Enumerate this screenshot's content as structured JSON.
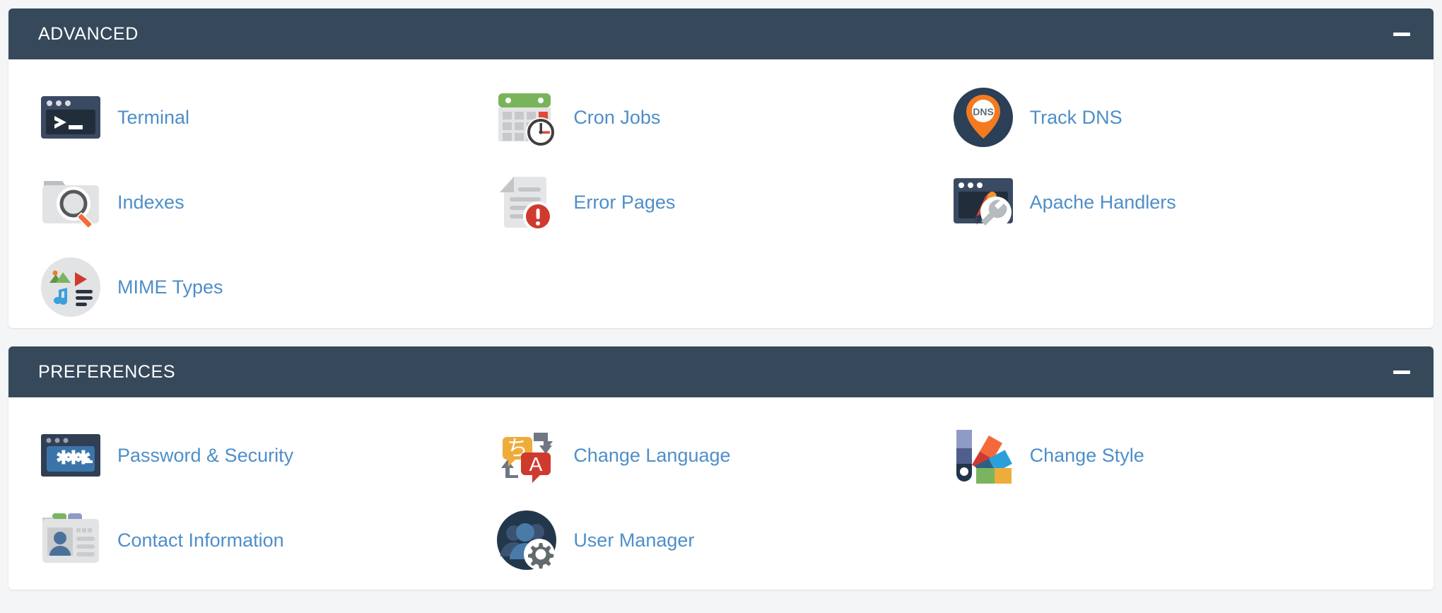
{
  "theme": {
    "header_bg": "#36495a",
    "panel_bg": "#ffffff",
    "page_bg": "#f4f5f6",
    "link_color": "#4f8ec9",
    "header_text": "#ffffff"
  },
  "panels": [
    {
      "title": "ADVANCED",
      "collapse_label": "−",
      "items": [
        {
          "label": "Terminal",
          "icon": "terminal-icon"
        },
        {
          "label": "Cron Jobs",
          "icon": "cron-jobs-calendar-clock-icon"
        },
        {
          "label": "Track DNS",
          "icon": "track-dns-pin-icon"
        },
        {
          "label": "Indexes",
          "icon": "indexes-folder-search-icon"
        },
        {
          "label": "Error Pages",
          "icon": "error-pages-document-alert-icon"
        },
        {
          "label": "Apache Handlers",
          "icon": "apache-handlers-feather-wrench-icon"
        },
        {
          "label": "MIME Types",
          "icon": "mime-types-media-icon"
        }
      ]
    },
    {
      "title": "PREFERENCES",
      "collapse_label": "−",
      "items": [
        {
          "label": "Password & Security",
          "icon": "password-security-asterisks-icon"
        },
        {
          "label": "Change Language",
          "icon": "change-language-bubbles-icon"
        },
        {
          "label": "Change Style",
          "icon": "change-style-swatches-icon"
        },
        {
          "label": "Contact Information",
          "icon": "contact-information-card-icon"
        },
        {
          "label": "User Manager",
          "icon": "user-manager-users-gear-icon"
        }
      ]
    }
  ]
}
